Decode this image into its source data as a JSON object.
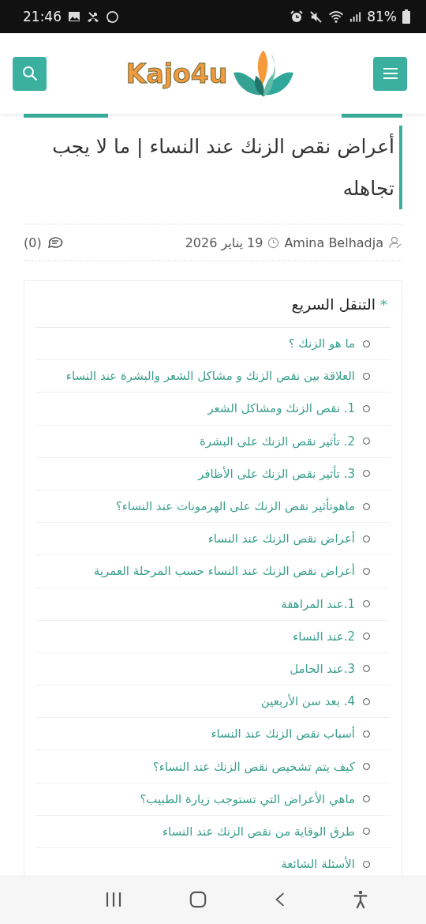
{
  "status_bar": {
    "time": "21:46",
    "battery": "81%"
  },
  "header": {
    "logo_text": "Kajo4u"
  },
  "article": {
    "title": "أعراض نقص الزنك عند النساء | ما لا يجب تجاهله",
    "author": "Amina Belhadja",
    "date": "19 يناير 2026",
    "comments": "(0)"
  },
  "toc": {
    "marker": "*",
    "title": "التنقل السريع",
    "items": [
      {
        "label": "ما هو الزنك ؟"
      },
      {
        "label": "العلاقة بين نقص الزنك و مشاكل الشعر والبشرة عند النساء"
      },
      {
        "label": "1. نقص الزنك ومشاكل الشعر"
      },
      {
        "label": "2. تأثير نقص الزنك على البشرة"
      },
      {
        "label": "3. تأثير نقص الزنك على الأظافر"
      },
      {
        "label": "ماهوتأثير نقص الزنك على الهرمونات عند النساء؟"
      },
      {
        "label": "أعراض نقص الزنك عند النساء"
      },
      {
        "label": "أعراض نقص الزنك عند النساء حسب المرحلة العمرية"
      },
      {
        "label": "1.عند المراهقة"
      },
      {
        "label": "2.عند النساء"
      },
      {
        "label": "3.عند الحامل"
      },
      {
        "label": "4. بعد سن الأربعين"
      },
      {
        "label": "أسباب نقص الزنك عند النساء"
      },
      {
        "label": "كيف يتم تشخيص نقص الزنك عند النساء؟"
      },
      {
        "label": "ماهي الأعراض التي تستوجب زيارة الطبيب؟"
      },
      {
        "label": "طرق الوقاية من نقص الزنك عند النساء"
      },
      {
        "label": "الأسئلة الشائعة"
      }
    ]
  }
}
